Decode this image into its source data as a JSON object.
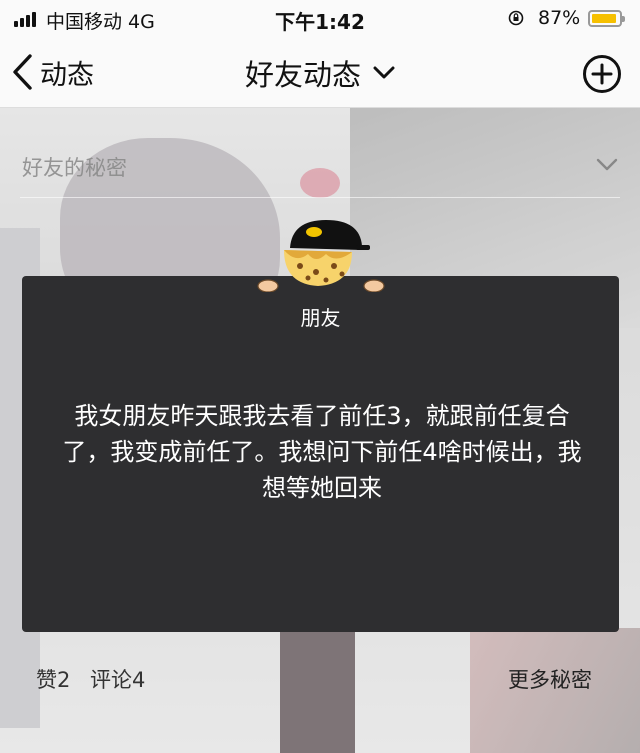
{
  "status_bar": {
    "carrier": "中国移动  4G",
    "time": "下午1:42",
    "battery_percent": "87%",
    "battery_level": 0.87,
    "battery_color": "#f6c000"
  },
  "nav": {
    "back_label": "动态",
    "title": "好友动态",
    "back_icon": "chevron-left-icon",
    "title_icon": "chevron-down-icon",
    "add_icon": "plus-circle-icon"
  },
  "section": {
    "secret_label": "好友的秘密"
  },
  "card": {
    "tag": "朋友",
    "content": "我女朋友昨天跟我去看了前任3，就跟前任复合了，我变成前任了。我想问下前任4啥时候出，我想等她回来",
    "background_color": "#2e2e30"
  },
  "footer": {
    "likes": "赞2",
    "comments": "评论4",
    "more": "更多秘密"
  }
}
